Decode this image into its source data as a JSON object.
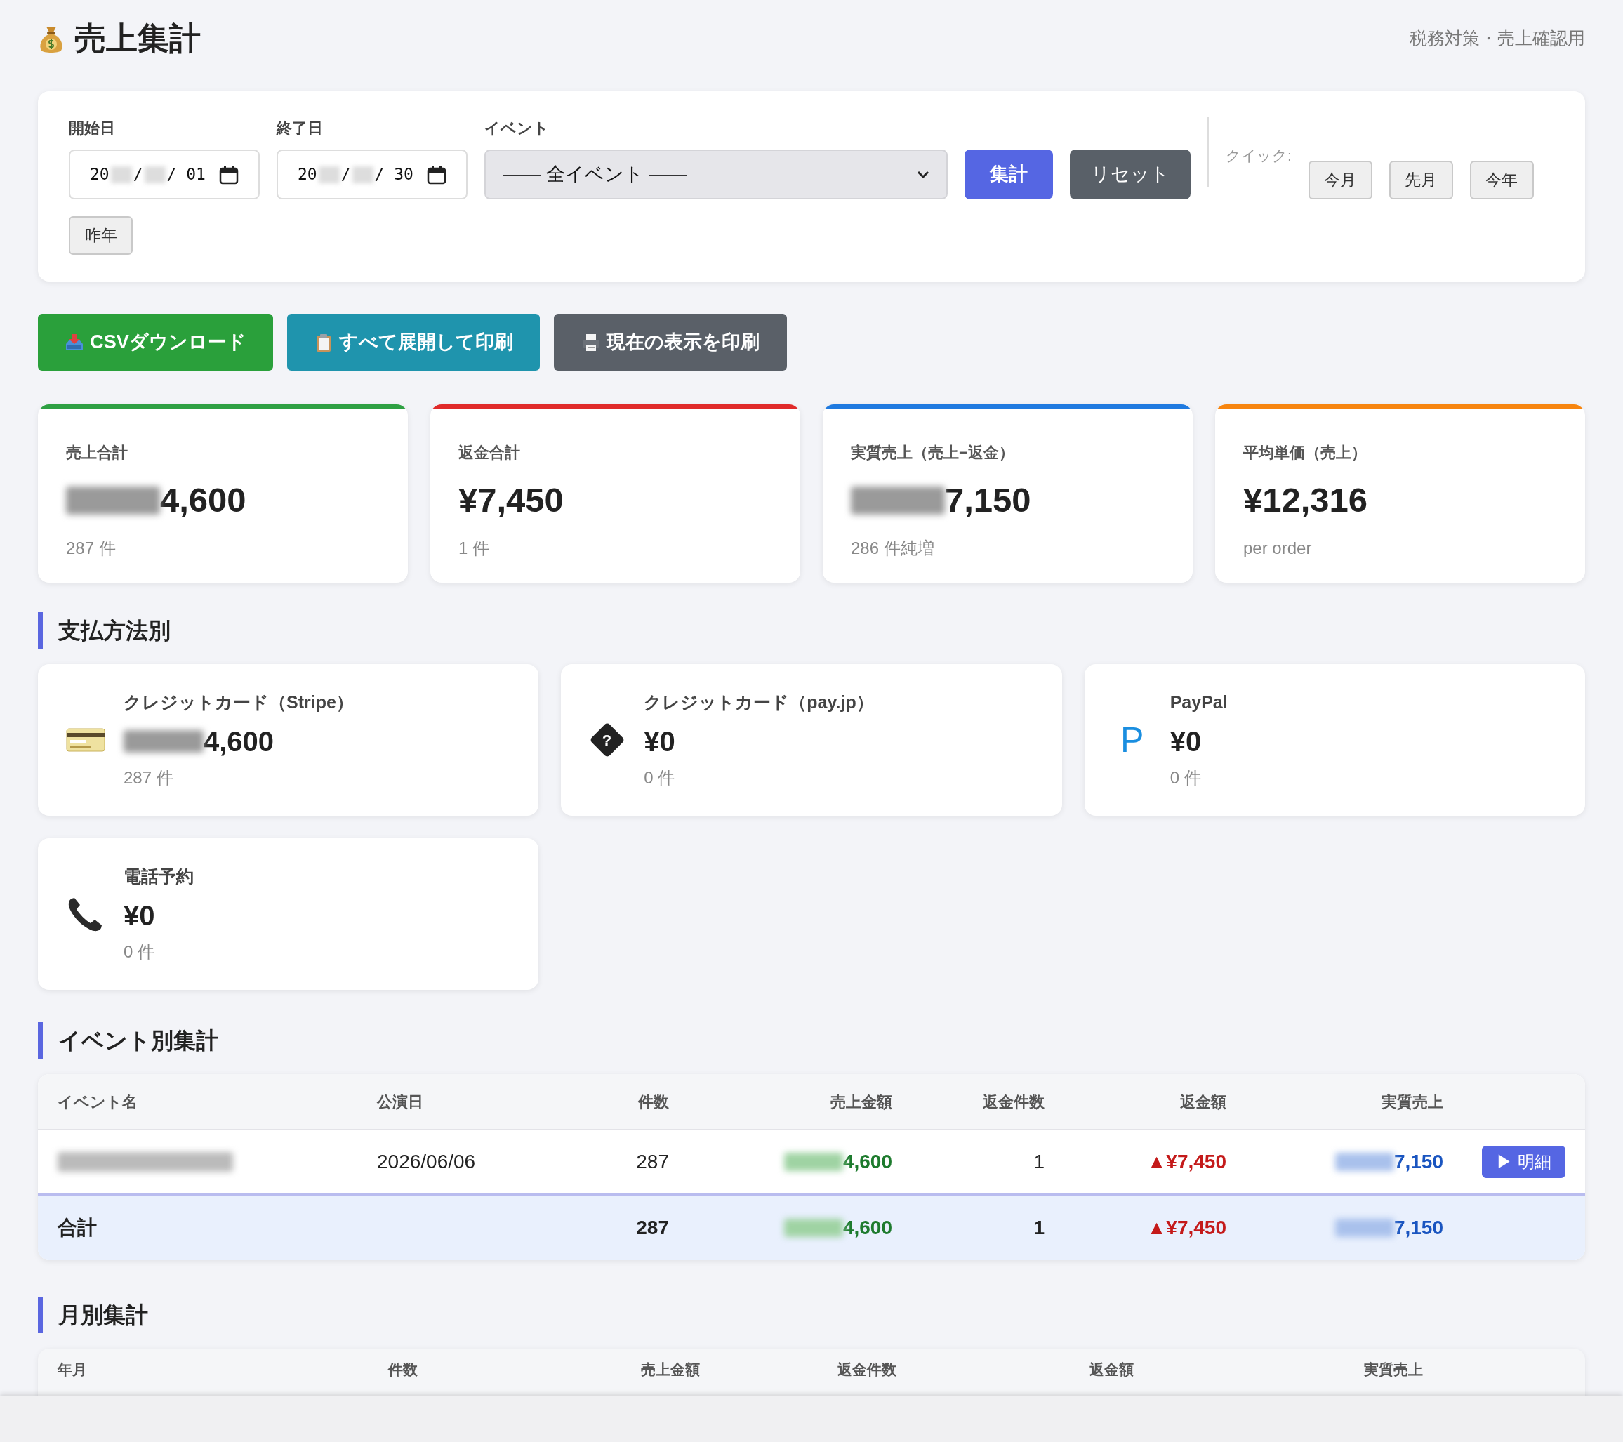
{
  "header": {
    "title": "売上集計",
    "subtitle": "税務対策・売上確認用"
  },
  "filters": {
    "start": {
      "label": "開始日",
      "parts": [
        "20",
        "/",
        "/ 01"
      ]
    },
    "end": {
      "label": "終了日",
      "parts": [
        "20",
        "/",
        "/ 30"
      ]
    },
    "event": {
      "label": "イベント",
      "value": "—— 全イベント ——"
    },
    "buttons": [
      {
        "label": "集計",
        "kind": "primary"
      },
      {
        "label": "リセット",
        "kind": "secondary"
      }
    ],
    "quick_label": "クイック:",
    "quick_buttons": [
      "今月",
      "先月",
      "今年",
      "昨年"
    ]
  },
  "actions": [
    {
      "label": "CSVダウンロード",
      "kind": "csv"
    },
    {
      "label": "すべて展開して印刷",
      "kind": "expand"
    },
    {
      "label": "現在の表示を印刷",
      "kind": "print"
    }
  ],
  "stats": [
    {
      "label": "売上合計",
      "value": "4,600",
      "redacted": true,
      "sub": "287 件",
      "color": "#2ea043"
    },
    {
      "label": "返金合計",
      "value": "¥7,450",
      "redacted": false,
      "sub": "1 件",
      "color": "#e02a2a"
    },
    {
      "label": "実質売上（売上−返金）",
      "value": "7,150",
      "redacted": true,
      "sub": "286 件純増",
      "color": "#1f7ae0"
    },
    {
      "label": "平均単価（売上）",
      "value": "¥12,316",
      "redacted": false,
      "sub": "per order",
      "color": "#f7850f"
    }
  ],
  "payments": {
    "title": "支払方法別",
    "items": [
      {
        "name": "クレジットカード（Stripe）",
        "kind": "card",
        "amount": "4,600",
        "redacted": true,
        "count": "287 件"
      },
      {
        "name": "クレジットカード（pay.jp）",
        "kind": "unknown",
        "glyph": "?",
        "amount": "¥0",
        "redacted": false,
        "count": "0 件"
      },
      {
        "name": "PayPal",
        "kind": "letter",
        "glyph": "P",
        "amount": "¥0",
        "redacted": false,
        "count": "0 件"
      },
      {
        "name": "電話予約",
        "kind": "phone",
        "amount": "¥0",
        "redacted": false,
        "count": "0 件"
      }
    ]
  },
  "events": {
    "title": "イベント別集計",
    "columns": [
      "イベント名",
      "公演日",
      "件数",
      "売上金額",
      "返金件数",
      "返金額",
      "実質売上"
    ],
    "rows": [
      {
        "name_redacted": true,
        "date": "2026/06/06",
        "count": "287",
        "sales": "4,600",
        "refund_count": "1",
        "refund": "▲¥7,450",
        "net": "7,150",
        "detail_button": "▶ 明細"
      }
    ],
    "total": {
      "label": "合計",
      "count": "287",
      "sales": "4,600",
      "refund_count": "1",
      "refund": "▲¥7,450",
      "net": "7,150"
    }
  },
  "monthly": {
    "title": "月別集計",
    "columns": [
      "年月",
      "件数",
      "売上金額",
      "返金件数",
      "返金額",
      "実質売上"
    ]
  }
}
